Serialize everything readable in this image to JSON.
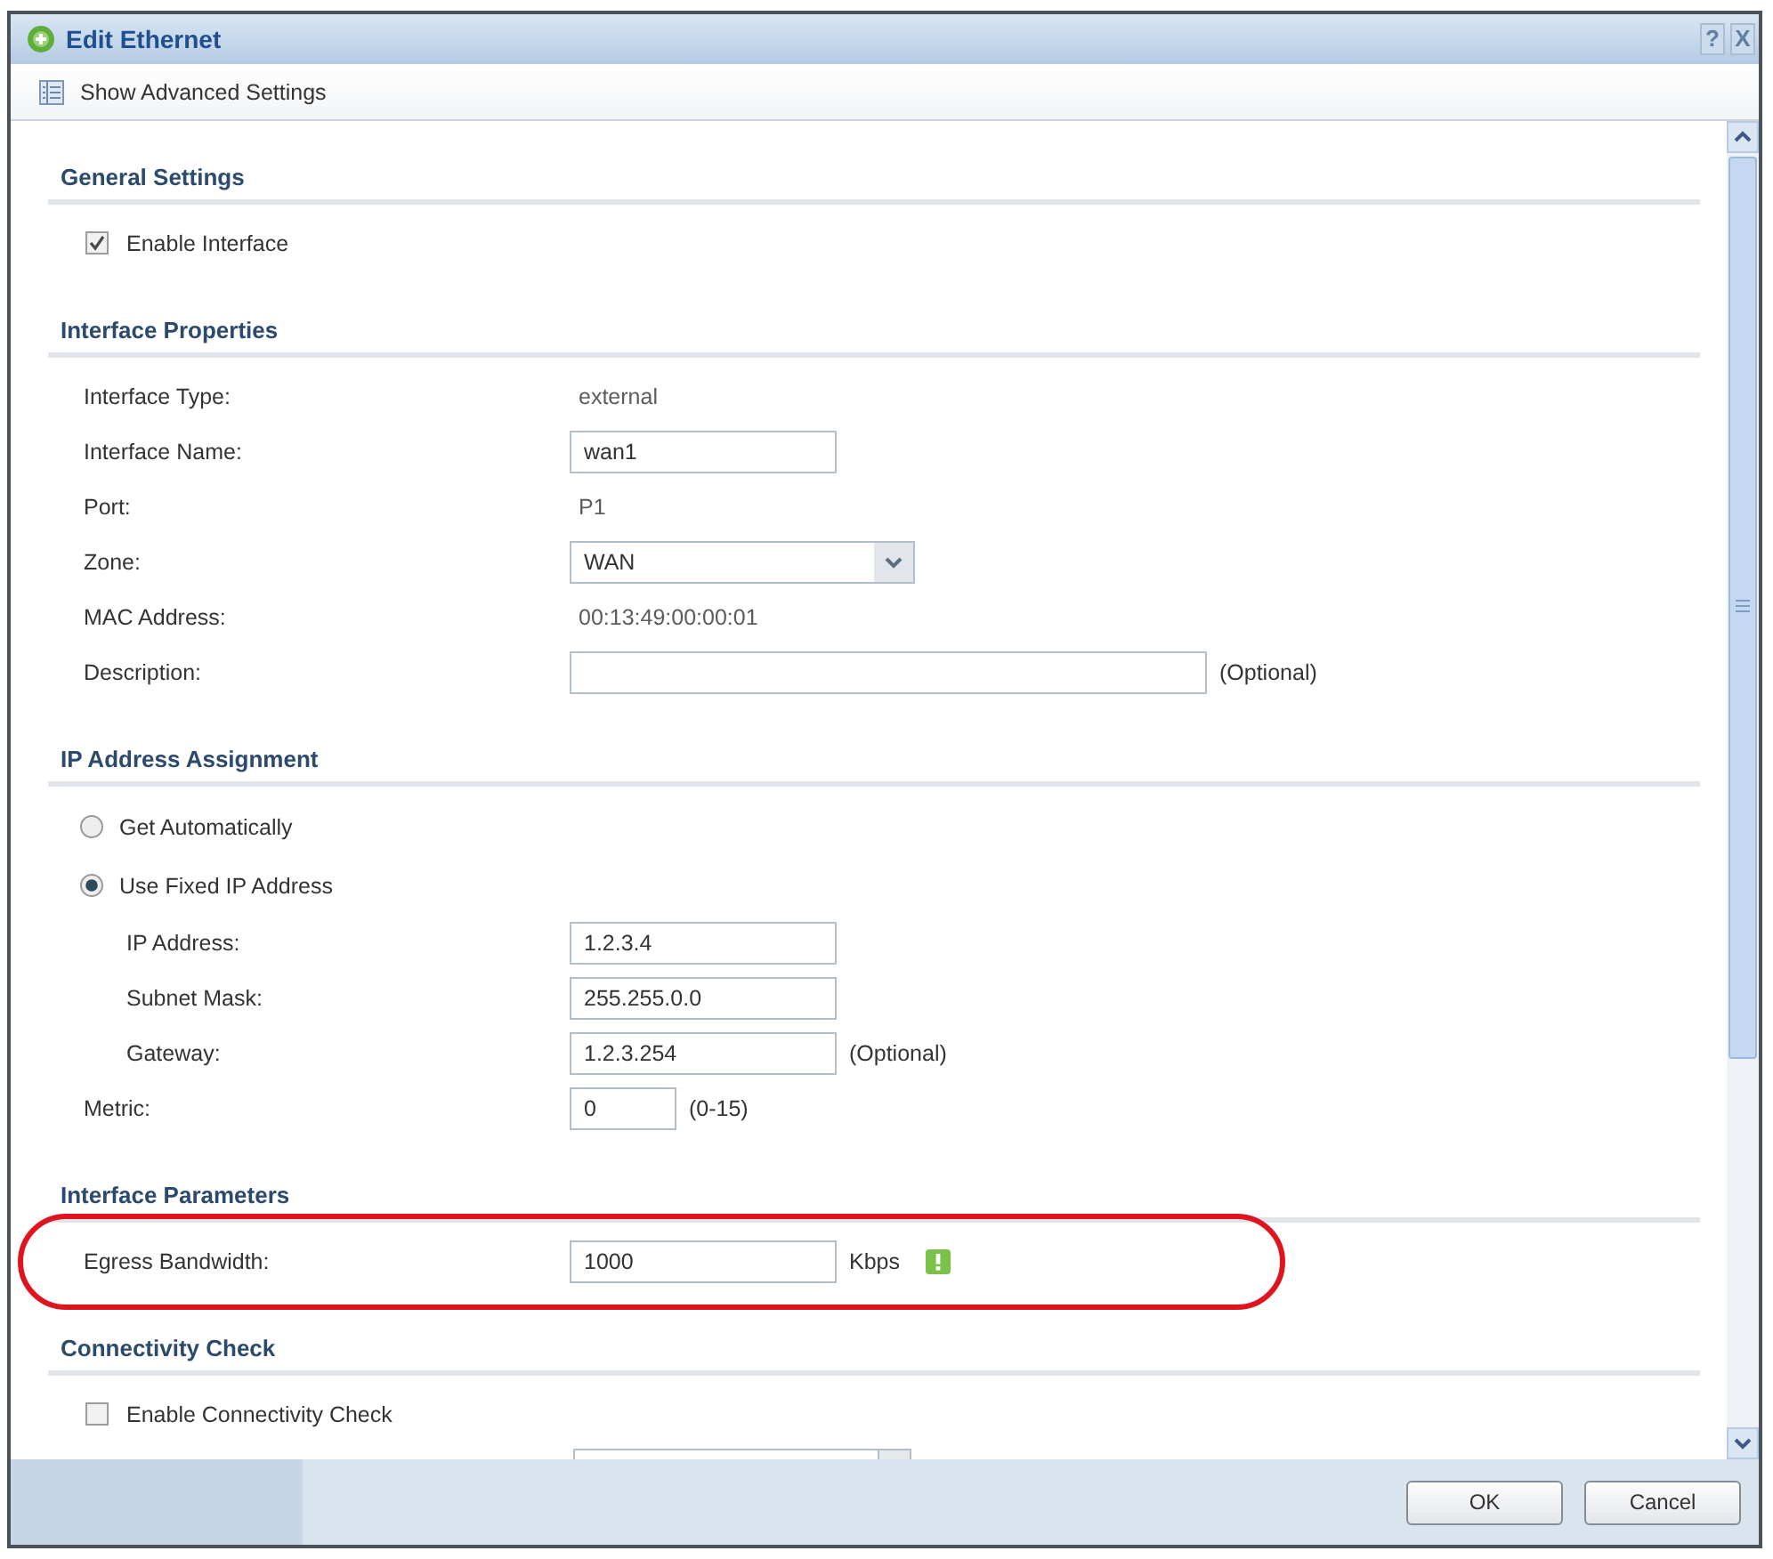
{
  "window": {
    "title": "Edit Ethernet",
    "help_button": "?",
    "close_button": "X"
  },
  "toolbar": {
    "label": "Show Advanced Settings"
  },
  "sections": [
    {
      "title": "General Settings",
      "rows": [
        {
          "kind": "checkbox",
          "label": "Enable Interface",
          "checked": true
        }
      ]
    },
    {
      "title": "Interface Properties",
      "rows": [
        {
          "kind": "text",
          "label": "Interface Type:",
          "value": "external"
        },
        {
          "kind": "input",
          "label": "Interface Name:",
          "value": "wan1"
        },
        {
          "kind": "text",
          "label": "Port:",
          "value": "P1"
        },
        {
          "kind": "select",
          "label": "Zone:",
          "value": "WAN"
        },
        {
          "kind": "text",
          "label": "MAC Address:",
          "value": "00:13:49:00:00:01"
        },
        {
          "kind": "wide_input",
          "label": "Description:",
          "note": "(Optional)"
        }
      ]
    },
    {
      "title": "IP Address Assignment",
      "rows": [
        {
          "kind": "radio",
          "label": "Get Automatically",
          "selected": false
        },
        {
          "kind": "radio",
          "label": "Use Fixed IP Address",
          "selected": true,
          "children": [
            {
              "kind": "input",
              "label": "IP Address:",
              "value": "1.2.3.4"
            },
            {
              "kind": "input",
              "label": "Subnet Mask:",
              "value": "255.255.0.0"
            },
            {
              "kind": "input",
              "label": "Gateway:",
              "value": "1.2.3.254",
              "note": "(Optional)"
            }
          ]
        },
        {
          "kind": "short_input",
          "label": "Metric:",
          "value": "0",
          "note": "(0-15)"
        }
      ]
    },
    {
      "title": "Interface Parameters",
      "rows": [
        {
          "kind": "input",
          "label": "Egress Bandwidth:",
          "value": "1000",
          "note": "Kbps",
          "help_icon": true,
          "highlighted": true
        }
      ]
    },
    {
      "title": "Connectivity Check",
      "rows": [
        {
          "kind": "checkbox",
          "label": "Enable Connectivity Check",
          "checked": false
        },
        {
          "kind": "cut_off_select"
        }
      ]
    }
  ],
  "buttons": [
    "OK",
    "Cancel"
  ]
}
